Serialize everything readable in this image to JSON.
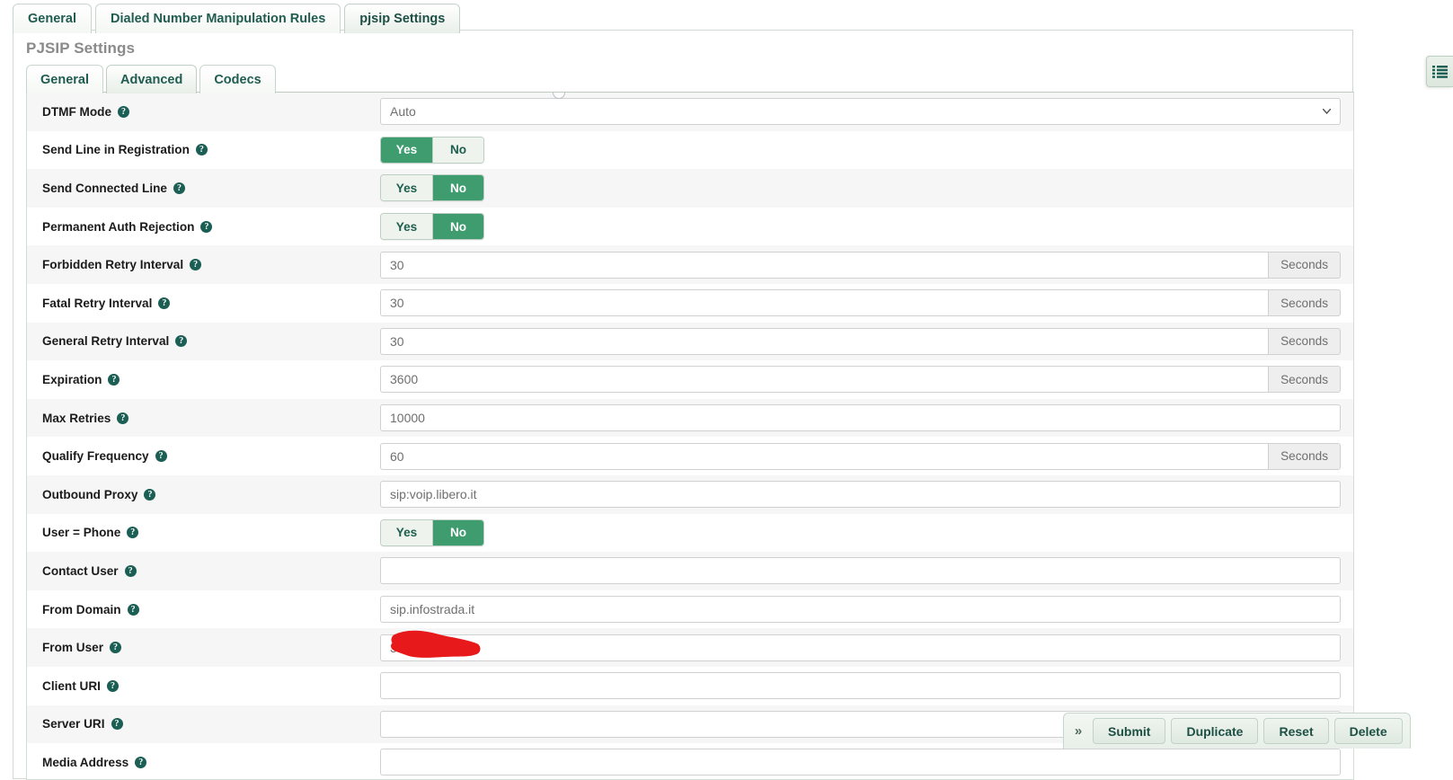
{
  "outer_tabs": [
    {
      "label": "General",
      "active": false
    },
    {
      "label": "Dialed Number Manipulation Rules",
      "active": false
    },
    {
      "label": "pjsip Settings",
      "active": true
    }
  ],
  "panel": {
    "title": "PJSIP Settings"
  },
  "inner_tabs": [
    {
      "label": "General",
      "active": false
    },
    {
      "label": "Advanced",
      "active": true
    },
    {
      "label": "Codecs",
      "active": false
    }
  ],
  "toggle_labels": {
    "yes": "Yes",
    "no": "No"
  },
  "addon_seconds": "Seconds",
  "form_rows": [
    {
      "label": "DTMF Mode",
      "type": "select",
      "value": "Auto",
      "options": [
        "Auto"
      ]
    },
    {
      "label": "Send Line in Registration",
      "type": "toggle",
      "value": "Yes"
    },
    {
      "label": "Send Connected Line",
      "type": "toggle",
      "value": "No"
    },
    {
      "label": "Permanent Auth Rejection",
      "type": "toggle",
      "value": "No"
    },
    {
      "label": "Forbidden Retry Interval",
      "type": "text",
      "value": "30",
      "addon": "Seconds"
    },
    {
      "label": "Fatal Retry Interval",
      "type": "text",
      "value": "30",
      "addon": "Seconds"
    },
    {
      "label": "General Retry Interval",
      "type": "text",
      "value": "30",
      "addon": "Seconds"
    },
    {
      "label": "Expiration",
      "type": "text",
      "value": "3600",
      "addon": "Seconds"
    },
    {
      "label": "Max Retries",
      "type": "text",
      "value": "10000",
      "addon": ""
    },
    {
      "label": "Qualify Frequency",
      "type": "text",
      "value": "60",
      "addon": "Seconds"
    },
    {
      "label": "Outbound Proxy",
      "type": "text",
      "value": "sip:voip.libero.it",
      "addon": ""
    },
    {
      "label": "User = Phone",
      "type": "toggle",
      "value": "No"
    },
    {
      "label": "Contact User",
      "type": "text",
      "value": "",
      "addon": ""
    },
    {
      "label": "From Domain",
      "type": "text",
      "value": "sip.infostrada.it",
      "addon": ""
    },
    {
      "label": "From User",
      "type": "text",
      "value": "39",
      "addon": "",
      "redacted": true
    },
    {
      "label": "Client URI",
      "type": "text",
      "value": "",
      "addon": ""
    },
    {
      "label": "Server URI",
      "type": "text",
      "value": "",
      "addon": ""
    },
    {
      "label": "Media Address",
      "type": "text",
      "value": "",
      "addon": ""
    }
  ],
  "action_bar": {
    "expand_label": "»",
    "buttons": [
      {
        "label": "Submit"
      },
      {
        "label": "Duplicate"
      },
      {
        "label": "Reset"
      },
      {
        "label": "Delete"
      }
    ]
  },
  "edge_tab": {
    "icon": "list-menu-icon"
  },
  "colors": {
    "toggle_on": "#3f9c6f",
    "toggle_off_bg": "#eef3ee",
    "accent_text": "#1d5e4c",
    "help_icon": "#1b5e54",
    "redaction": "#e8191b",
    "stripe": "#f6f6f6"
  }
}
